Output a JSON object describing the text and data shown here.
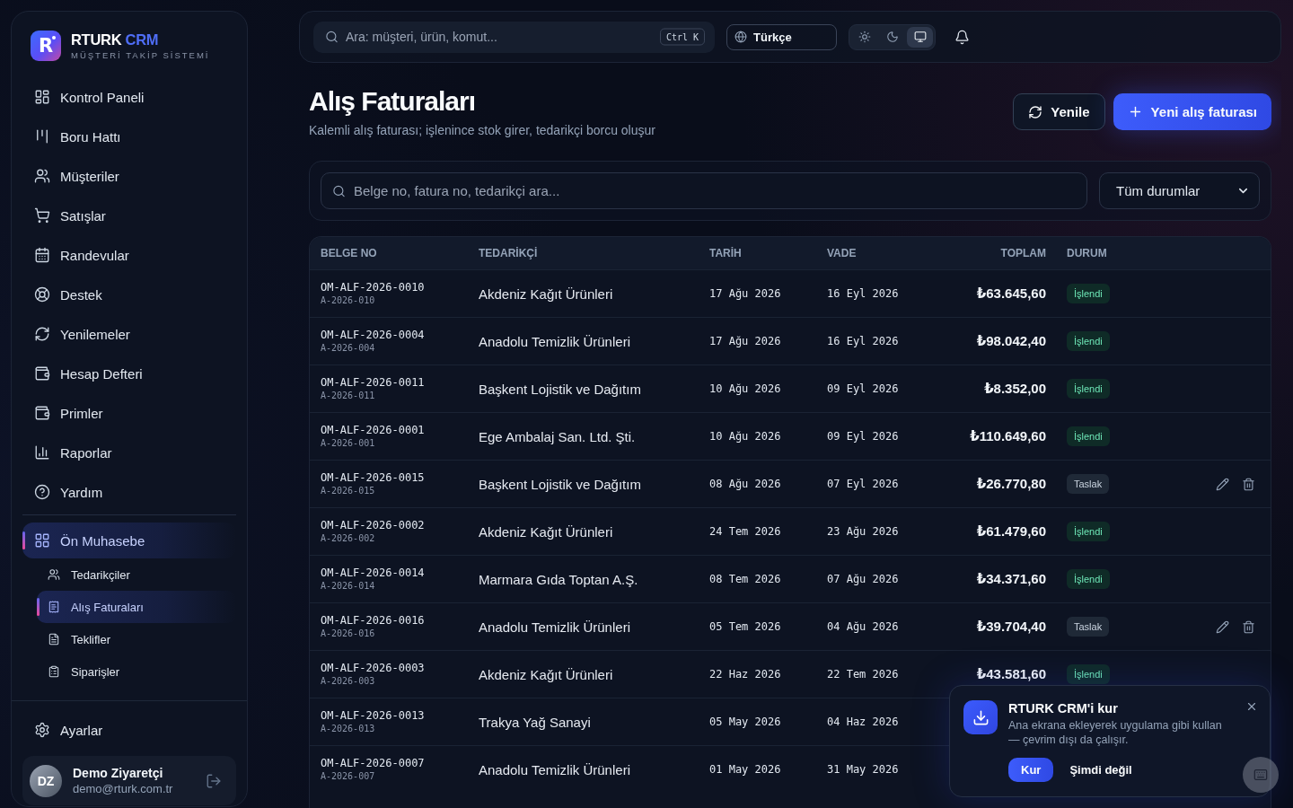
{
  "sidebar": {
    "logo": {
      "letter": "R",
      "name": "RTURK",
      "name_accent": "CRM",
      "tagline": "MÜŞTERİ TAKİP SİSTEMİ"
    },
    "items": [
      {
        "label": "Kontrol Paneli",
        "kind": "link",
        "selected": false
      },
      {
        "label": "Boru Hattı",
        "kind": "link",
        "selected": false
      },
      {
        "label": "Müşteriler",
        "kind": "link",
        "selected": false
      },
      {
        "label": "Satışlar",
        "kind": "link",
        "selected": false
      },
      {
        "label": "Randevular",
        "kind": "link",
        "selected": false
      },
      {
        "label": "Destek",
        "kind": "link",
        "selected": false
      },
      {
        "label": "Yenilemeler",
        "kind": "link",
        "selected": false
      },
      {
        "label": "Hesap Defteri",
        "kind": "link",
        "selected": false
      },
      {
        "label": "Primler",
        "kind": "link",
        "selected": false
      },
      {
        "label": "Raporlar",
        "kind": "link",
        "selected": false
      },
      {
        "label": "Yardım",
        "kind": "link",
        "selected": false
      },
      {
        "label": "Ön Muhasebe",
        "kind": "group",
        "selected": true,
        "children": [
          {
            "label": "Tedarikçiler",
            "selected": false
          },
          {
            "label": "Alış Faturaları",
            "selected": true
          },
          {
            "label": "Teklifler",
            "selected": false
          },
          {
            "label": "Siparişler",
            "selected": false
          }
        ]
      }
    ],
    "settings": {
      "label": "Ayarlar"
    },
    "user": {
      "initials": "DZ",
      "name": "Demo Ziyaretçi",
      "email": "demo@rturk.com.tr"
    }
  },
  "topbar": {
    "search": {
      "placeholder": "Ara: müşteri, ürün, komut...",
      "shortcut": "Ctrl K"
    },
    "language": "Türkçe",
    "theme_toggle": [
      {
        "selected": false
      },
      {
        "selected": false
      },
      {
        "selected": true
      }
    ]
  },
  "header": {
    "title": "Alış Faturaları",
    "subtitle": "Kalemli alış faturası; işlenince stok girer, tedarikçi borcu oluşur",
    "buttons": [
      {
        "label": "Yenile",
        "kind": "secondary"
      },
      {
        "label": "Yeni alış faturası",
        "kind": "primary"
      }
    ]
  },
  "filters": {
    "search": {
      "placeholder": "Belge no, fatura no, tedarikçi ara..."
    },
    "status_select": "Tüm durumlar"
  },
  "table": {
    "columns": [
      "BELGE NO",
      "TEDARİKÇİ",
      "TARİH",
      "VADE",
      "TOPLAM",
      "DURUM"
    ],
    "rows": [
      {
        "doc_no": "OM-ALF-2026-0010",
        "ref": "A-2026-010",
        "supplier": "Akdeniz Kağıt Ürünleri",
        "date": "17 Ağu 2026",
        "due": "16 Eyl 2026",
        "total": "₺63.645,60",
        "status": {
          "label": "İşlendi",
          "kind": "processed"
        },
        "editable": false
      },
      {
        "doc_no": "OM-ALF-2026-0004",
        "ref": "A-2026-004",
        "supplier": "Anadolu Temizlik Ürünleri",
        "date": "17 Ağu 2026",
        "due": "16 Eyl 2026",
        "total": "₺98.042,40",
        "status": {
          "label": "İşlendi",
          "kind": "processed"
        },
        "editable": false
      },
      {
        "doc_no": "OM-ALF-2026-0011",
        "ref": "A-2026-011",
        "supplier": "Başkent Lojistik ve Dağıtım",
        "date": "10 Ağu 2026",
        "due": "09 Eyl 2026",
        "total": "₺8.352,00",
        "status": {
          "label": "İşlendi",
          "kind": "processed"
        },
        "editable": false
      },
      {
        "doc_no": "OM-ALF-2026-0001",
        "ref": "A-2026-001",
        "supplier": "Ege Ambalaj San. Ltd. Şti.",
        "date": "10 Ağu 2026",
        "due": "09 Eyl 2026",
        "total": "₺110.649,60",
        "status": {
          "label": "İşlendi",
          "kind": "processed"
        },
        "editable": false
      },
      {
        "doc_no": "OM-ALF-2026-0015",
        "ref": "A-2026-015",
        "supplier": "Başkent Lojistik ve Dağıtım",
        "date": "08 Ağu 2026",
        "due": "07 Eyl 2026",
        "total": "₺26.770,80",
        "status": {
          "label": "Taslak",
          "kind": "draft"
        },
        "editable": true
      },
      {
        "doc_no": "OM-ALF-2026-0002",
        "ref": "A-2026-002",
        "supplier": "Akdeniz Kağıt Ürünleri",
        "date": "24 Tem 2026",
        "due": "23 Ağu 2026",
        "total": "₺61.479,60",
        "status": {
          "label": "İşlendi",
          "kind": "processed"
        },
        "editable": false
      },
      {
        "doc_no": "OM-ALF-2026-0014",
        "ref": "A-2026-014",
        "supplier": "Marmara Gıda Toptan A.Ş.",
        "date": "08 Tem 2026",
        "due": "07 Ağu 2026",
        "total": "₺34.371,60",
        "status": {
          "label": "İşlendi",
          "kind": "processed"
        },
        "editable": false
      },
      {
        "doc_no": "OM-ALF-2026-0016",
        "ref": "A-2026-016",
        "supplier": "Anadolu Temizlik Ürünleri",
        "date": "05 Tem 2026",
        "due": "04 Ağu 2026",
        "total": "₺39.704,40",
        "status": {
          "label": "Taslak",
          "kind": "draft"
        },
        "editable": true
      },
      {
        "doc_no": "OM-ALF-2026-0003",
        "ref": "A-2026-003",
        "supplier": "Akdeniz Kağıt Ürünleri",
        "date": "22 Haz 2026",
        "due": "22 Tem 2026",
        "total": "₺43.581,60",
        "status": {
          "label": "İşlendi",
          "kind": "processed"
        },
        "editable": false
      },
      {
        "doc_no": "OM-ALF-2026-0013",
        "ref": "A-2026-013",
        "supplier": "Trakya Yağ Sanayi",
        "date": "05 May 2026",
        "due": "04 Haz 2026",
        "editable": false
      },
      {
        "doc_no": "OM-ALF-2026-0007",
        "ref": "A-2026-007",
        "supplier": "Anadolu Temizlik Ürünleri",
        "date": "01 May 2026",
        "due": "31 May 2026",
        "editable": false
      }
    ]
  },
  "install_prompt": {
    "title": "RTURK CRM'i kur",
    "description": "Ana ekrana ekleyerek uygulama gibi kullan — çevrim dışı da çalışır.",
    "buttons": [
      {
        "label": "Kur",
        "kind": "primary"
      },
      {
        "label": "Şimdi değil",
        "kind": "text"
      }
    ]
  }
}
